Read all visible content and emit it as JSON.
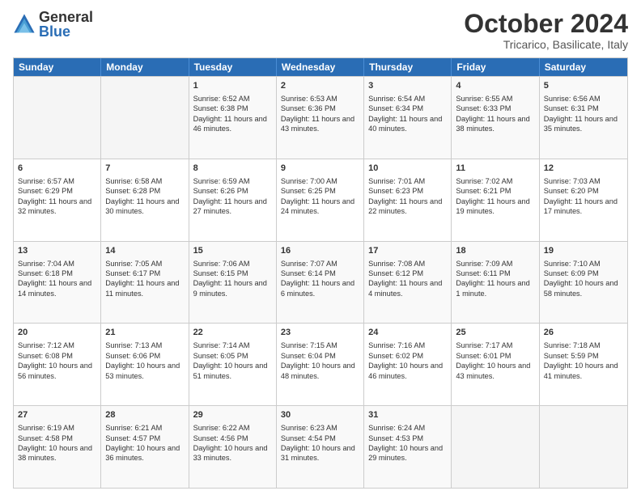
{
  "logo": {
    "general": "General",
    "blue": "Blue"
  },
  "title": "October 2024",
  "location": "Tricarico, Basilicate, Italy",
  "weekdays": [
    "Sunday",
    "Monday",
    "Tuesday",
    "Wednesday",
    "Thursday",
    "Friday",
    "Saturday"
  ],
  "rows": [
    [
      {
        "day": "",
        "text": ""
      },
      {
        "day": "",
        "text": ""
      },
      {
        "day": "1",
        "text": "Sunrise: 6:52 AM\nSunset: 6:38 PM\nDaylight: 11 hours and 46 minutes."
      },
      {
        "day": "2",
        "text": "Sunrise: 6:53 AM\nSunset: 6:36 PM\nDaylight: 11 hours and 43 minutes."
      },
      {
        "day": "3",
        "text": "Sunrise: 6:54 AM\nSunset: 6:34 PM\nDaylight: 11 hours and 40 minutes."
      },
      {
        "day": "4",
        "text": "Sunrise: 6:55 AM\nSunset: 6:33 PM\nDaylight: 11 hours and 38 minutes."
      },
      {
        "day": "5",
        "text": "Sunrise: 6:56 AM\nSunset: 6:31 PM\nDaylight: 11 hours and 35 minutes."
      }
    ],
    [
      {
        "day": "6",
        "text": "Sunrise: 6:57 AM\nSunset: 6:29 PM\nDaylight: 11 hours and 32 minutes."
      },
      {
        "day": "7",
        "text": "Sunrise: 6:58 AM\nSunset: 6:28 PM\nDaylight: 11 hours and 30 minutes."
      },
      {
        "day": "8",
        "text": "Sunrise: 6:59 AM\nSunset: 6:26 PM\nDaylight: 11 hours and 27 minutes."
      },
      {
        "day": "9",
        "text": "Sunrise: 7:00 AM\nSunset: 6:25 PM\nDaylight: 11 hours and 24 minutes."
      },
      {
        "day": "10",
        "text": "Sunrise: 7:01 AM\nSunset: 6:23 PM\nDaylight: 11 hours and 22 minutes."
      },
      {
        "day": "11",
        "text": "Sunrise: 7:02 AM\nSunset: 6:21 PM\nDaylight: 11 hours and 19 minutes."
      },
      {
        "day": "12",
        "text": "Sunrise: 7:03 AM\nSunset: 6:20 PM\nDaylight: 11 hours and 17 minutes."
      }
    ],
    [
      {
        "day": "13",
        "text": "Sunrise: 7:04 AM\nSunset: 6:18 PM\nDaylight: 11 hours and 14 minutes."
      },
      {
        "day": "14",
        "text": "Sunrise: 7:05 AM\nSunset: 6:17 PM\nDaylight: 11 hours and 11 minutes."
      },
      {
        "day": "15",
        "text": "Sunrise: 7:06 AM\nSunset: 6:15 PM\nDaylight: 11 hours and 9 minutes."
      },
      {
        "day": "16",
        "text": "Sunrise: 7:07 AM\nSunset: 6:14 PM\nDaylight: 11 hours and 6 minutes."
      },
      {
        "day": "17",
        "text": "Sunrise: 7:08 AM\nSunset: 6:12 PM\nDaylight: 11 hours and 4 minutes."
      },
      {
        "day": "18",
        "text": "Sunrise: 7:09 AM\nSunset: 6:11 PM\nDaylight: 11 hours and 1 minute."
      },
      {
        "day": "19",
        "text": "Sunrise: 7:10 AM\nSunset: 6:09 PM\nDaylight: 10 hours and 58 minutes."
      }
    ],
    [
      {
        "day": "20",
        "text": "Sunrise: 7:12 AM\nSunset: 6:08 PM\nDaylight: 10 hours and 56 minutes."
      },
      {
        "day": "21",
        "text": "Sunrise: 7:13 AM\nSunset: 6:06 PM\nDaylight: 10 hours and 53 minutes."
      },
      {
        "day": "22",
        "text": "Sunrise: 7:14 AM\nSunset: 6:05 PM\nDaylight: 10 hours and 51 minutes."
      },
      {
        "day": "23",
        "text": "Sunrise: 7:15 AM\nSunset: 6:04 PM\nDaylight: 10 hours and 48 minutes."
      },
      {
        "day": "24",
        "text": "Sunrise: 7:16 AM\nSunset: 6:02 PM\nDaylight: 10 hours and 46 minutes."
      },
      {
        "day": "25",
        "text": "Sunrise: 7:17 AM\nSunset: 6:01 PM\nDaylight: 10 hours and 43 minutes."
      },
      {
        "day": "26",
        "text": "Sunrise: 7:18 AM\nSunset: 5:59 PM\nDaylight: 10 hours and 41 minutes."
      }
    ],
    [
      {
        "day": "27",
        "text": "Sunrise: 6:19 AM\nSunset: 4:58 PM\nDaylight: 10 hours and 38 minutes."
      },
      {
        "day": "28",
        "text": "Sunrise: 6:21 AM\nSunset: 4:57 PM\nDaylight: 10 hours and 36 minutes."
      },
      {
        "day": "29",
        "text": "Sunrise: 6:22 AM\nSunset: 4:56 PM\nDaylight: 10 hours and 33 minutes."
      },
      {
        "day": "30",
        "text": "Sunrise: 6:23 AM\nSunset: 4:54 PM\nDaylight: 10 hours and 31 minutes."
      },
      {
        "day": "31",
        "text": "Sunrise: 6:24 AM\nSunset: 4:53 PM\nDaylight: 10 hours and 29 minutes."
      },
      {
        "day": "",
        "text": ""
      },
      {
        "day": "",
        "text": ""
      }
    ]
  ]
}
